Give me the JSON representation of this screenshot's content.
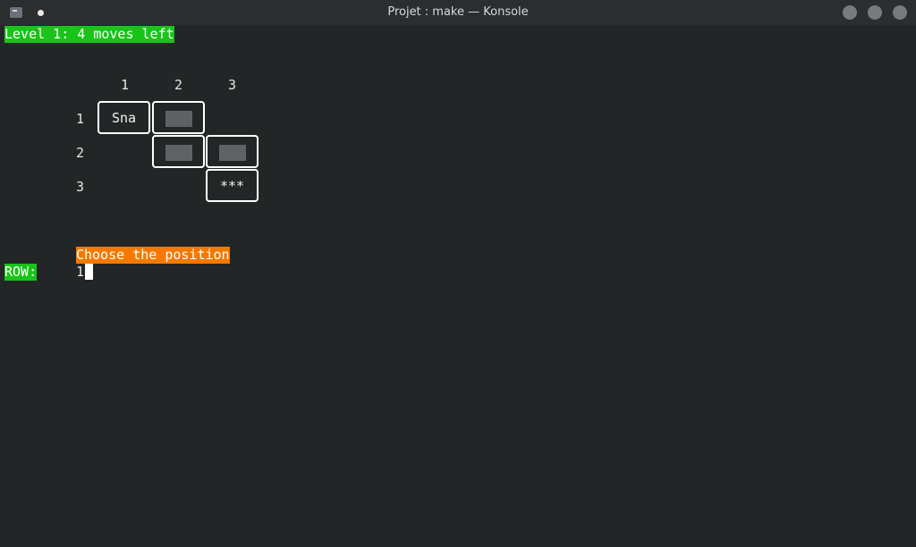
{
  "window": {
    "title": "Projet : make — Konsole"
  },
  "terminal": {
    "level_banner": "Level 1: 4 moves left",
    "column_headers": [
      "1",
      "2",
      "3"
    ],
    "row_headers": [
      "1",
      "2",
      "3"
    ],
    "cells": {
      "r1c1": "Sna",
      "r3c3": "***"
    },
    "prompt_banner": "Choose the position",
    "row_label": "ROW:",
    "row_input_value": "1"
  },
  "colors": {
    "background": "#232627",
    "green_highlight": "#18c418",
    "orange_highlight": "#f57900",
    "hidden_cell": "#5f6264"
  }
}
